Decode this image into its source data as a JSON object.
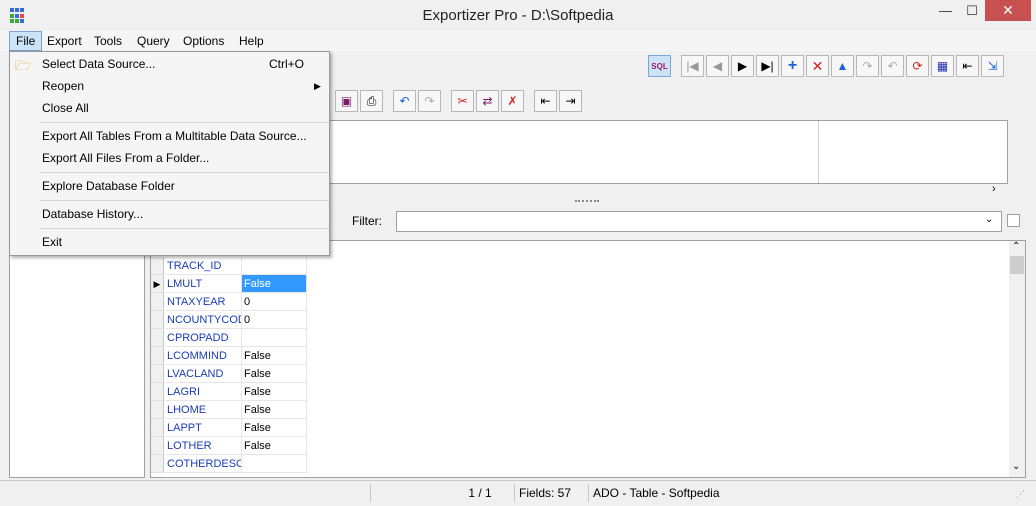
{
  "window": {
    "title": "Exportizer Pro - D:\\Softpedia",
    "min": "—",
    "max": "☐",
    "close": "✕"
  },
  "menubar": [
    "File",
    "Export",
    "Tools",
    "Query",
    "Options",
    "Help"
  ],
  "file_menu": {
    "items": [
      {
        "label": "Select Data Source...",
        "shortcut": "Ctrl+O"
      },
      {
        "label": "Reopen",
        "submenu": "▶"
      },
      {
        "label": "Close All"
      },
      {
        "label": "Export All Tables From a Multitable Data Source..."
      },
      {
        "label": "Export All Files From a Folder..."
      },
      {
        "label": "Explore Database Folder"
      },
      {
        "label": "Database History..."
      },
      {
        "label": "Exit"
      }
    ]
  },
  "filter": {
    "label": "Filter:",
    "value": ""
  },
  "grid": {
    "rows": [
      {
        "name": "TRACK_ID",
        "value": ""
      },
      {
        "name": "LMULT",
        "value": "False",
        "selected": true
      },
      {
        "name": "NTAXYEAR",
        "value": "0"
      },
      {
        "name": "NCOUNTYCOD",
        "value": "0"
      },
      {
        "name": "CPROPADD",
        "value": ""
      },
      {
        "name": "LCOMMIND",
        "value": "False"
      },
      {
        "name": "LVACLAND",
        "value": "False"
      },
      {
        "name": "LAGRI",
        "value": "False"
      },
      {
        "name": "LHOME",
        "value": "False"
      },
      {
        "name": "LAPPT",
        "value": "False"
      },
      {
        "name": "LOTHER",
        "value": "False"
      },
      {
        "name": "COTHERDESC",
        "value": ""
      }
    ]
  },
  "status": {
    "position": "1 / 1",
    "fields": "Fields: 57",
    "source": "ADO - Table - Softpedia"
  },
  "colors": {
    "accent": "#3399ff",
    "field_name": "#1a3db5",
    "close": "#c75050"
  }
}
